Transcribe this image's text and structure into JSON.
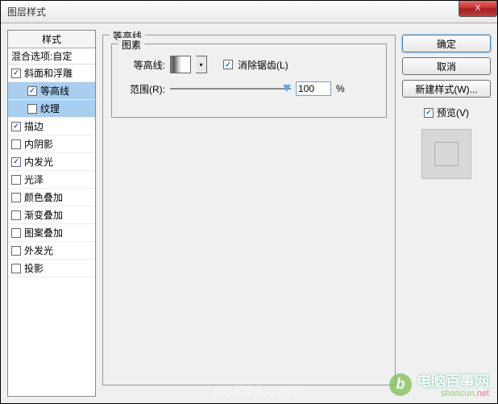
{
  "title": "图层样式",
  "close_x": "X",
  "styles": {
    "header": "样式",
    "blend_options": "混合选项:自定",
    "items": [
      {
        "label": "斜面和浮雕",
        "checked": true,
        "selected": false,
        "sub": false
      },
      {
        "label": "等高线",
        "checked": true,
        "selected": true,
        "sub": true
      },
      {
        "label": "纹理",
        "checked": false,
        "selected": true,
        "sub": true
      },
      {
        "label": "描边",
        "checked": true,
        "selected": false,
        "sub": false
      },
      {
        "label": "内阴影",
        "checked": false,
        "selected": false,
        "sub": false
      },
      {
        "label": "内发光",
        "checked": true,
        "selected": false,
        "sub": false
      },
      {
        "label": "光泽",
        "checked": false,
        "selected": false,
        "sub": false
      },
      {
        "label": "颜色叠加",
        "checked": false,
        "selected": false,
        "sub": false
      },
      {
        "label": "渐变叠加",
        "checked": false,
        "selected": false,
        "sub": false
      },
      {
        "label": "图案叠加",
        "checked": false,
        "selected": false,
        "sub": false
      },
      {
        "label": "外发光",
        "checked": false,
        "selected": false,
        "sub": false
      },
      {
        "label": "投影",
        "checked": false,
        "selected": false,
        "sub": false
      }
    ]
  },
  "main": {
    "group_label": "等高线",
    "elements_label": "图素",
    "contour_label": "等高线:",
    "antialias_label": "消除锯齿(L)",
    "antialias_checked": true,
    "range_label": "范围(R):",
    "range_value": "100",
    "range_unit": "%"
  },
  "buttons": {
    "ok": "确定",
    "cancel": "取消",
    "new_style": "新建样式(W)...",
    "preview": "预览(V)",
    "preview_checked": true
  },
  "watermark": {
    "brand": "电脑百事网",
    "sub": "shancun",
    "net": ".net",
    "logo_text": "b"
  }
}
